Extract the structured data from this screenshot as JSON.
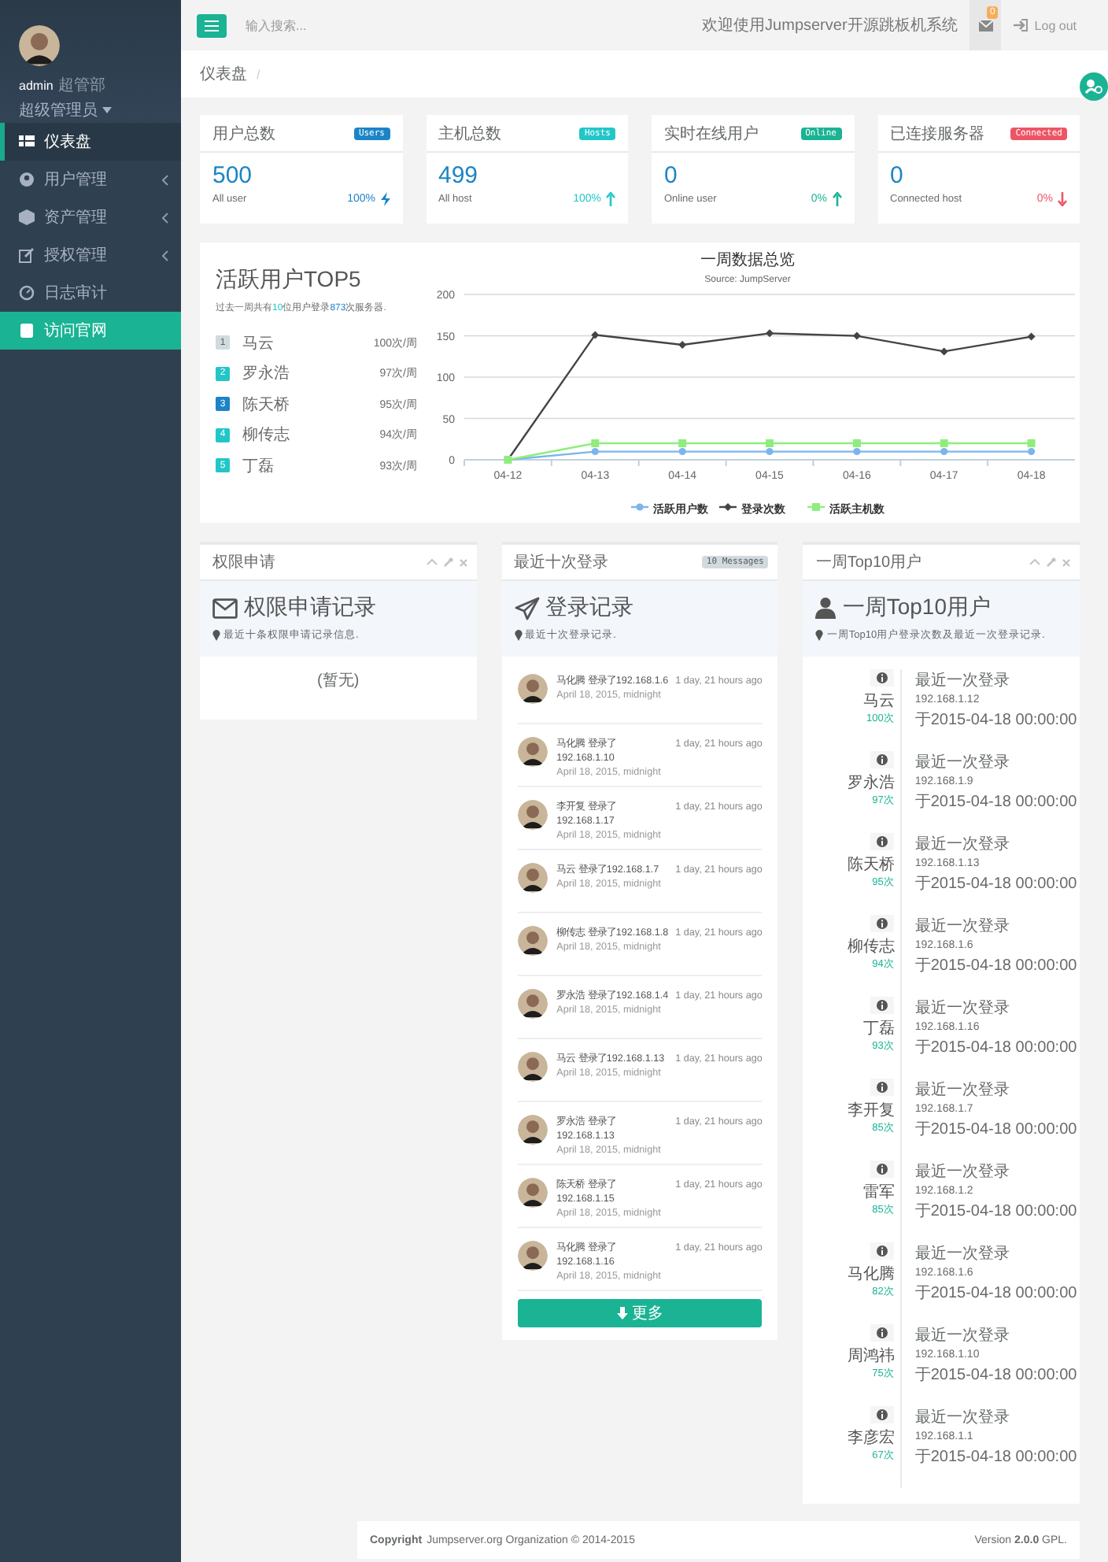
{
  "sidebar": {
    "profile": {
      "name": "admin",
      "department": "超管部",
      "role": "超级管理员"
    },
    "items": [
      {
        "label": "仪表盘",
        "kind": "plain",
        "selected": true
      },
      {
        "label": "用户管理",
        "kind": "submenu",
        "selected": false
      },
      {
        "label": "资产管理",
        "kind": "submenu",
        "selected": false
      },
      {
        "label": "授权管理",
        "kind": "submenu",
        "selected": false
      },
      {
        "label": "日志审计",
        "kind": "plain",
        "selected": false
      },
      {
        "label": "访问官网",
        "kind": "link",
        "selected": false
      }
    ]
  },
  "topbar": {
    "search": {
      "placeholder": "输入搜索..."
    },
    "welcome": "欢迎使用Jumpserver开源跳板机系统",
    "mail_count": "0",
    "logout": "Log out"
  },
  "breadcrumb": [
    "仪表盘",
    "/"
  ],
  "stats": [
    {
      "title": "用户总数",
      "badge": "Users",
      "color": "#1c84c6",
      "value": "500",
      "caption": "All user",
      "percent": "100%",
      "kind": "bolt"
    },
    {
      "title": "主机总数",
      "badge": "Hosts",
      "color": "#23c6c8",
      "value": "499",
      "caption": "All host",
      "percent": "100%",
      "kind": "up"
    },
    {
      "title": "实时在线用户",
      "badge": "Online",
      "color": "#1ab394",
      "value": "0",
      "caption": "Online user",
      "percent": "0%",
      "kind": "up"
    },
    {
      "title": "已连接服务器",
      "badge": "Connected",
      "color": "#ed5565",
      "value": "0",
      "caption": "Connected host",
      "percent": "0%",
      "kind": "down"
    }
  ],
  "top5": {
    "title": "活跃用户TOP5",
    "summary": {
      "before": "过去一周共有",
      "users": "10",
      "middle": "位用户登录",
      "logins": "873",
      "after": "次服务器."
    },
    "users": [
      {
        "rank": "1",
        "name": "马云",
        "count": "100次/周",
        "color": "#d1dade"
      },
      {
        "rank": "2",
        "name": "罗永浩",
        "count": "97次/周",
        "color": "#23c6c8"
      },
      {
        "rank": "3",
        "name": "陈天桥",
        "count": "95次/周",
        "color": "#1c84c6"
      },
      {
        "rank": "4",
        "name": "柳传志",
        "count": "94次/周",
        "color": "#23c6c8"
      },
      {
        "rank": "5",
        "name": "丁磊",
        "count": "93次/周",
        "color": "#23c6c8"
      }
    ]
  },
  "weekly": {
    "subtitle": "Source: JumpServer",
    "chart_data": {
      "type": "line",
      "title": "一周数据总览",
      "categories": [
        "04-12",
        "04-13",
        "04-14",
        "04-15",
        "04-16",
        "04-17",
        "04-18"
      ],
      "ylim": [
        0,
        200
      ],
      "yticks": [
        0,
        50,
        100,
        150,
        200
      ],
      "grid": true,
      "legend": true,
      "series": [
        {
          "name": "活跃用户数",
          "color": "#7cb5ec",
          "marker": "circle",
          "values": [
            0,
            10,
            10,
            10,
            10,
            10,
            10
          ]
        },
        {
          "name": "登录次数",
          "color": "#434348",
          "marker": "diamond",
          "values": [
            0,
            151,
            139,
            153,
            150,
            131,
            149
          ]
        },
        {
          "name": "活跃主机数",
          "color": "#90ed7d",
          "marker": "square",
          "values": [
            0,
            20,
            20,
            20,
            20,
            20,
            20
          ]
        }
      ]
    }
  },
  "permission_panel": {
    "title": "权限申请",
    "heading": "权限申请记录",
    "hint": "最近十条权限申请记录信息.",
    "empty": "(暂无)"
  },
  "login_panel": {
    "title": "最近十次登录",
    "badge": "10 Messages",
    "heading": "登录记录",
    "hint": "最近十次登录记录.",
    "more": "更多",
    "records": [
      {
        "text": "马化腾 登录了192.168.1.6",
        "ago": "1 day, 21 hours ago",
        "date": "April 18, 2015, midnight"
      },
      {
        "text": "马化腾 登录了 192.168.1.10",
        "ago": "1 day, 21 hours ago",
        "date": "April 18, 2015, midnight"
      },
      {
        "text": "李开复 登录了 192.168.1.17",
        "ago": "1 day, 21 hours ago",
        "date": "April 18, 2015, midnight"
      },
      {
        "text": "马云 登录了192.168.1.7",
        "ago": "1 day, 21 hours ago",
        "date": "April 18, 2015, midnight"
      },
      {
        "text": "柳传志 登录了192.168.1.8",
        "ago": "1 day, 21 hours ago",
        "date": "April 18, 2015, midnight"
      },
      {
        "text": "罗永浩 登录了192.168.1.4",
        "ago": "1 day, 21 hours ago",
        "date": "April 18, 2015, midnight"
      },
      {
        "text": "马云 登录了192.168.1.13",
        "ago": "1 day, 21 hours ago",
        "date": "April 18, 2015, midnight"
      },
      {
        "text": "罗永浩 登录了 192.168.1.13",
        "ago": "1 day, 21 hours ago",
        "date": "April 18, 2015, midnight"
      },
      {
        "text": "陈天桥 登录了 192.168.1.15",
        "ago": "1 day, 21 hours ago",
        "date": "April 18, 2015, midnight"
      },
      {
        "text": "马化腾 登录了 192.168.1.16",
        "ago": "1 day, 21 hours ago",
        "date": "April 18, 2015, midnight"
      }
    ]
  },
  "top10_panel": {
    "title": "一周Top10用户",
    "heading": "一周Top10用户",
    "hint": "一周Top10用户登录次数及最近一次登录记录.",
    "users": [
      {
        "name": "马云",
        "count": "100次",
        "label": "最近一次登录",
        "ip": "192.168.1.12",
        "time": "于2015-04-18 00:00:00"
      },
      {
        "name": "罗永浩",
        "count": "97次",
        "label": "最近一次登录",
        "ip": "192.168.1.9",
        "time": "于2015-04-18 00:00:00"
      },
      {
        "name": "陈天桥",
        "count": "95次",
        "label": "最近一次登录",
        "ip": "192.168.1.13",
        "time": "于2015-04-18 00:00:00"
      },
      {
        "name": "柳传志",
        "count": "94次",
        "label": "最近一次登录",
        "ip": "192.168.1.6",
        "time": "于2015-04-18 00:00:00"
      },
      {
        "name": "丁磊",
        "count": "93次",
        "label": "最近一次登录",
        "ip": "192.168.1.16",
        "time": "于2015-04-18 00:00:00"
      },
      {
        "name": "李开复",
        "count": "85次",
        "label": "最近一次登录",
        "ip": "192.168.1.7",
        "time": "于2015-04-18 00:00:00"
      },
      {
        "name": "雷军",
        "count": "85次",
        "label": "最近一次登录",
        "ip": "192.168.1.2",
        "time": "于2015-04-18 00:00:00"
      },
      {
        "name": "马化腾",
        "count": "82次",
        "label": "最近一次登录",
        "ip": "192.168.1.6",
        "time": "于2015-04-18 00:00:00"
      },
      {
        "name": "周鸿祎",
        "count": "75次",
        "label": "最近一次登录",
        "ip": "192.168.1.10",
        "time": "于2015-04-18 00:00:00"
      },
      {
        "name": "李彦宏",
        "count": "67次",
        "label": "最近一次登录",
        "ip": "192.168.1.1",
        "time": "于2015-04-18 00:00:00"
      }
    ]
  },
  "footer": {
    "copyright_label": "Copyright",
    "copyright": "Jumpserver.org Organization © 2014-2015",
    "version": "Version **2.0.0** GPL."
  }
}
